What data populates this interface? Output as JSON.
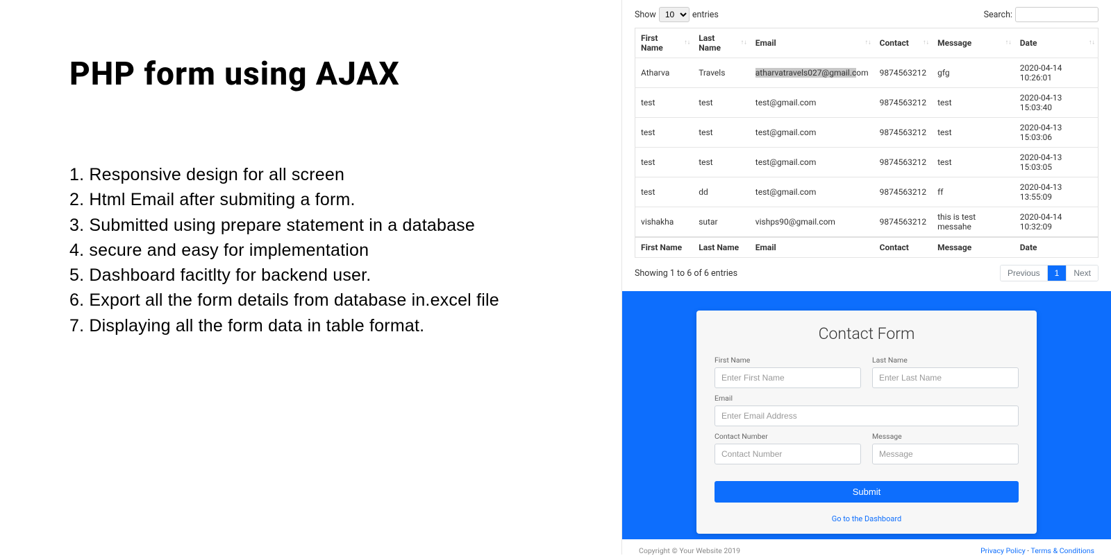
{
  "left": {
    "title": "PHP form using AJAX",
    "features": [
      "1. Responsive design for all screen",
      "2. Html Email after submiting a form.",
      "3. Submitted using prepare statement in a database",
      "4. secure and easy for implementation",
      "5. Dashboard facitlty for backend user.",
      "6. Export all the form details from database in.excel file",
      "7. Displaying all the form data in table format."
    ]
  },
  "datatable": {
    "show_label": "Show",
    "entries_label": "entries",
    "length_value": "10",
    "search_label": "Search:",
    "columns": [
      "First Name",
      "Last Name",
      "Email",
      "Contact",
      "Message",
      "Date"
    ],
    "rows": [
      {
        "first": "Atharva",
        "last": "Travels",
        "email": "atharvatravels027@gmail.com",
        "contact": "9874563212",
        "message": "gfg",
        "date": "2020-04-14 10:26:01",
        "email_hl": true
      },
      {
        "first": "test",
        "last": "test",
        "email": "test@gmail.com",
        "contact": "9874563212",
        "message": "test",
        "date": "2020-04-13 15:03:40"
      },
      {
        "first": "test",
        "last": "test",
        "email": "test@gmail.com",
        "contact": "9874563212",
        "message": "test",
        "date": "2020-04-13 15:03:06"
      },
      {
        "first": "test",
        "last": "test",
        "email": "test@gmail.com",
        "contact": "9874563212",
        "message": "test",
        "date": "2020-04-13 15:03:05"
      },
      {
        "first": "test",
        "last": "dd",
        "email": "test@gmail.com",
        "contact": "9874563212",
        "message": "ff",
        "date": "2020-04-13 13:55:09"
      },
      {
        "first": "vishakha",
        "last": "sutar",
        "email": "vishps90@gmail.com",
        "contact": "9874563212",
        "message": "this is test messahe",
        "date": "2020-04-14 10:32:09"
      }
    ],
    "info": "Showing 1 to 6 of 6 entries",
    "prev": "Previous",
    "page": "1",
    "next": "Next"
  },
  "form": {
    "title": "Contact Form",
    "first_label": "First Name",
    "last_label": "Last Name",
    "email_label": "Email",
    "contact_label": "Contact Number",
    "message_label": "Message",
    "first_ph": "Enter First Name",
    "last_ph": "Enter Last Name",
    "email_ph": "Enter Email Address",
    "contact_ph": "Contact Number",
    "message_ph": "Message",
    "submit": "Submit",
    "dashboard": "Go to the Dashboard"
  },
  "footer": {
    "copyright": "Copyright © Your Website 2019",
    "privacy": "Privacy Policy",
    "dot": " · ",
    "terms": "Terms & Conditions"
  }
}
